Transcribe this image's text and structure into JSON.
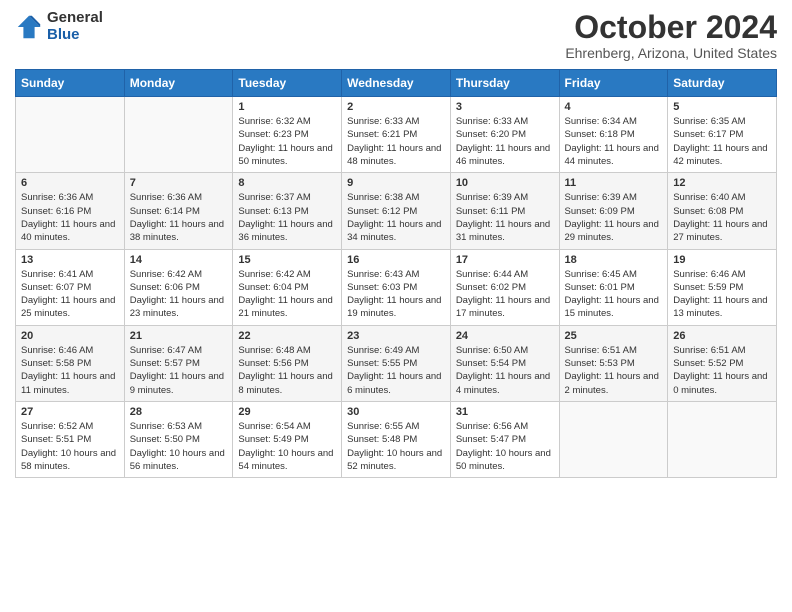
{
  "header": {
    "logo_general": "General",
    "logo_blue": "Blue",
    "month_title": "October 2024",
    "location": "Ehrenberg, Arizona, United States"
  },
  "days_of_week": [
    "Sunday",
    "Monday",
    "Tuesday",
    "Wednesday",
    "Thursday",
    "Friday",
    "Saturday"
  ],
  "weeks": [
    [
      {
        "day": "",
        "sunrise": "",
        "sunset": "",
        "daylight": ""
      },
      {
        "day": "",
        "sunrise": "",
        "sunset": "",
        "daylight": ""
      },
      {
        "day": "1",
        "sunrise": "Sunrise: 6:32 AM",
        "sunset": "Sunset: 6:23 PM",
        "daylight": "Daylight: 11 hours and 50 minutes."
      },
      {
        "day": "2",
        "sunrise": "Sunrise: 6:33 AM",
        "sunset": "Sunset: 6:21 PM",
        "daylight": "Daylight: 11 hours and 48 minutes."
      },
      {
        "day": "3",
        "sunrise": "Sunrise: 6:33 AM",
        "sunset": "Sunset: 6:20 PM",
        "daylight": "Daylight: 11 hours and 46 minutes."
      },
      {
        "day": "4",
        "sunrise": "Sunrise: 6:34 AM",
        "sunset": "Sunset: 6:18 PM",
        "daylight": "Daylight: 11 hours and 44 minutes."
      },
      {
        "day": "5",
        "sunrise": "Sunrise: 6:35 AM",
        "sunset": "Sunset: 6:17 PM",
        "daylight": "Daylight: 11 hours and 42 minutes."
      }
    ],
    [
      {
        "day": "6",
        "sunrise": "Sunrise: 6:36 AM",
        "sunset": "Sunset: 6:16 PM",
        "daylight": "Daylight: 11 hours and 40 minutes."
      },
      {
        "day": "7",
        "sunrise": "Sunrise: 6:36 AM",
        "sunset": "Sunset: 6:14 PM",
        "daylight": "Daylight: 11 hours and 38 minutes."
      },
      {
        "day": "8",
        "sunrise": "Sunrise: 6:37 AM",
        "sunset": "Sunset: 6:13 PM",
        "daylight": "Daylight: 11 hours and 36 minutes."
      },
      {
        "day": "9",
        "sunrise": "Sunrise: 6:38 AM",
        "sunset": "Sunset: 6:12 PM",
        "daylight": "Daylight: 11 hours and 34 minutes."
      },
      {
        "day": "10",
        "sunrise": "Sunrise: 6:39 AM",
        "sunset": "Sunset: 6:11 PM",
        "daylight": "Daylight: 11 hours and 31 minutes."
      },
      {
        "day": "11",
        "sunrise": "Sunrise: 6:39 AM",
        "sunset": "Sunset: 6:09 PM",
        "daylight": "Daylight: 11 hours and 29 minutes."
      },
      {
        "day": "12",
        "sunrise": "Sunrise: 6:40 AM",
        "sunset": "Sunset: 6:08 PM",
        "daylight": "Daylight: 11 hours and 27 minutes."
      }
    ],
    [
      {
        "day": "13",
        "sunrise": "Sunrise: 6:41 AM",
        "sunset": "Sunset: 6:07 PM",
        "daylight": "Daylight: 11 hours and 25 minutes."
      },
      {
        "day": "14",
        "sunrise": "Sunrise: 6:42 AM",
        "sunset": "Sunset: 6:06 PM",
        "daylight": "Daylight: 11 hours and 23 minutes."
      },
      {
        "day": "15",
        "sunrise": "Sunrise: 6:42 AM",
        "sunset": "Sunset: 6:04 PM",
        "daylight": "Daylight: 11 hours and 21 minutes."
      },
      {
        "day": "16",
        "sunrise": "Sunrise: 6:43 AM",
        "sunset": "Sunset: 6:03 PM",
        "daylight": "Daylight: 11 hours and 19 minutes."
      },
      {
        "day": "17",
        "sunrise": "Sunrise: 6:44 AM",
        "sunset": "Sunset: 6:02 PM",
        "daylight": "Daylight: 11 hours and 17 minutes."
      },
      {
        "day": "18",
        "sunrise": "Sunrise: 6:45 AM",
        "sunset": "Sunset: 6:01 PM",
        "daylight": "Daylight: 11 hours and 15 minutes."
      },
      {
        "day": "19",
        "sunrise": "Sunrise: 6:46 AM",
        "sunset": "Sunset: 5:59 PM",
        "daylight": "Daylight: 11 hours and 13 minutes."
      }
    ],
    [
      {
        "day": "20",
        "sunrise": "Sunrise: 6:46 AM",
        "sunset": "Sunset: 5:58 PM",
        "daylight": "Daylight: 11 hours and 11 minutes."
      },
      {
        "day": "21",
        "sunrise": "Sunrise: 6:47 AM",
        "sunset": "Sunset: 5:57 PM",
        "daylight": "Daylight: 11 hours and 9 minutes."
      },
      {
        "day": "22",
        "sunrise": "Sunrise: 6:48 AM",
        "sunset": "Sunset: 5:56 PM",
        "daylight": "Daylight: 11 hours and 8 minutes."
      },
      {
        "day": "23",
        "sunrise": "Sunrise: 6:49 AM",
        "sunset": "Sunset: 5:55 PM",
        "daylight": "Daylight: 11 hours and 6 minutes."
      },
      {
        "day": "24",
        "sunrise": "Sunrise: 6:50 AM",
        "sunset": "Sunset: 5:54 PM",
        "daylight": "Daylight: 11 hours and 4 minutes."
      },
      {
        "day": "25",
        "sunrise": "Sunrise: 6:51 AM",
        "sunset": "Sunset: 5:53 PM",
        "daylight": "Daylight: 11 hours and 2 minutes."
      },
      {
        "day": "26",
        "sunrise": "Sunrise: 6:51 AM",
        "sunset": "Sunset: 5:52 PM",
        "daylight": "Daylight: 11 hours and 0 minutes."
      }
    ],
    [
      {
        "day": "27",
        "sunrise": "Sunrise: 6:52 AM",
        "sunset": "Sunset: 5:51 PM",
        "daylight": "Daylight: 10 hours and 58 minutes."
      },
      {
        "day": "28",
        "sunrise": "Sunrise: 6:53 AM",
        "sunset": "Sunset: 5:50 PM",
        "daylight": "Daylight: 10 hours and 56 minutes."
      },
      {
        "day": "29",
        "sunrise": "Sunrise: 6:54 AM",
        "sunset": "Sunset: 5:49 PM",
        "daylight": "Daylight: 10 hours and 54 minutes."
      },
      {
        "day": "30",
        "sunrise": "Sunrise: 6:55 AM",
        "sunset": "Sunset: 5:48 PM",
        "daylight": "Daylight: 10 hours and 52 minutes."
      },
      {
        "day": "31",
        "sunrise": "Sunrise: 6:56 AM",
        "sunset": "Sunset: 5:47 PM",
        "daylight": "Daylight: 10 hours and 50 minutes."
      },
      {
        "day": "",
        "sunrise": "",
        "sunset": "",
        "daylight": ""
      },
      {
        "day": "",
        "sunrise": "",
        "sunset": "",
        "daylight": ""
      }
    ]
  ]
}
